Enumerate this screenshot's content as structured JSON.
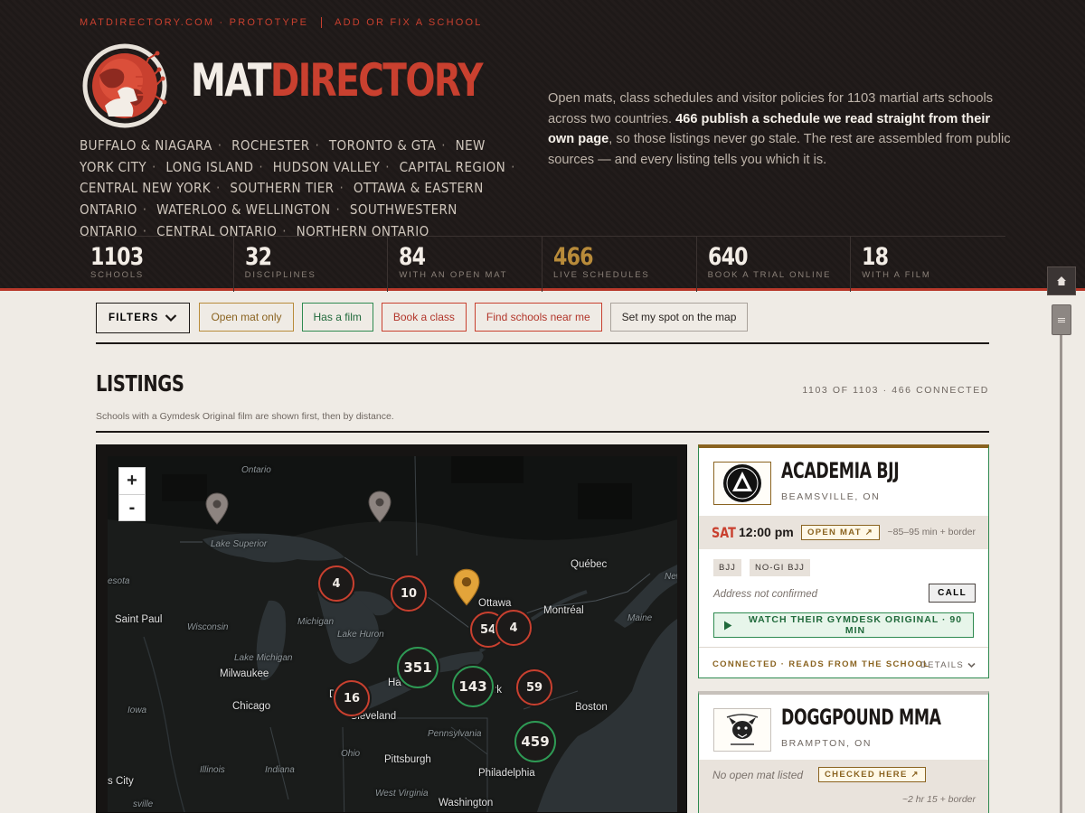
{
  "header": {
    "nav": {
      "site": "MATDIRECTORY.COM · PROTOTYPE",
      "add_fix": "ADD OR FIX A SCHOOL"
    },
    "brand": {
      "part1": "MAT",
      "part2": "DIRECTORY"
    },
    "regions": [
      "BUFFALO & NIAGARA",
      "ROCHESTER",
      "TORONTO & GTA",
      "NEW YORK CITY",
      "LONG ISLAND",
      "HUDSON VALLEY",
      "CAPITAL REGION",
      "CENTRAL NEW YORK",
      "SOUTHERN TIER",
      "OTTAWA & EASTERN ONTARIO",
      "WATERLOO & WELLINGTON",
      "SOUTHWESTERN ONTARIO",
      "CENTRAL ONTARIO",
      "NORTHERN ONTARIO"
    ],
    "intro": {
      "part1": "Open mats, class schedules and visitor policies for 1103 martial arts schools across two countries. ",
      "bold": "466 publish a schedule we read straight from their own page",
      "part2": ", so those listings never go stale. The rest are assembled from public sources — and every listing tells you which it is."
    },
    "stats": [
      {
        "value": "1103",
        "label": "SCHOOLS"
      },
      {
        "value": "32",
        "label": "DISCIPLINES"
      },
      {
        "value": "84",
        "label": "WITH AN OPEN MAT"
      },
      {
        "value": "466",
        "label": "LIVE SCHEDULES"
      },
      {
        "value": "640",
        "label": "BOOK A TRIAL ONLINE"
      },
      {
        "value": "18",
        "label": "WITH A FILM"
      }
    ]
  },
  "filters": {
    "main": "FILTERS",
    "open_mat": "Open mat only",
    "film": "Has a film",
    "book": "Book a class",
    "near": "Find schools near me",
    "spot": "Set my spot on the map"
  },
  "listings": {
    "title": "LISTINGS",
    "count": "1103 OF 1103 · 466 CONNECTED",
    "subtitle": "Schools with a Gymdesk Original film are shown first, then by distance."
  },
  "map": {
    "zoom_in": "+",
    "zoom_out": "-",
    "labels": {
      "ontario": "Ontario",
      "lake_superior": "Lake Superior",
      "esota": "esota",
      "saint_paul": "Saint Paul",
      "wisconsin": "Wisconsin",
      "michigan": "Michigan",
      "lake_huron": "Lake Huron",
      "lake_michigan": "Lake Michigan",
      "milwaukee": "Milwaukee",
      "chicago": "Chicago",
      "iowa": "Iowa",
      "illinois": "Illinois",
      "indiana": "Indiana",
      "ohio": "Ohio",
      "cleveland": "Cleveland",
      "pittsburgh": "Pittsburgh",
      "pennsylvania": "Pennsylvania",
      "philadelphia": "Philadelphia",
      "washington": "Washington",
      "west_virginia": "West Virginia",
      "s_city": "s City",
      "sville": "sville",
      "ottawa": "Ottawa",
      "montreal": "Montréal",
      "quebec": "Québec",
      "maine": "Maine",
      "boston": "Boston",
      "new": "New",
      "ork": "ork",
      "ha": "Ha",
      "d": "D"
    },
    "clusters": {
      "c4a": "4",
      "c10": "10",
      "c54": "54",
      "c4b": "4",
      "c351": "351",
      "c143": "143",
      "c59": "59",
      "c16": "16",
      "c459": "459"
    }
  },
  "cards": [
    {
      "name": "ACADEMIA BJJ",
      "city": "BEAMSVILLE, ON",
      "day": "SAT",
      "time": "12:00 pm",
      "open_mat": "OPEN MAT ↗",
      "distance": "~85–95 min + border",
      "tags": [
        "BJJ",
        "NO-GI BJJ"
      ],
      "address": "Address not confirmed",
      "call": "CALL",
      "watch": "WATCH THEIR GYMDESK ORIGINAL · 90 MIN",
      "connected": "CONNECTED · READS FROM THE SCHOOL",
      "details": "DETAILS"
    },
    {
      "name": "DOGGPOUND MMA",
      "city": "BRAMPTON, ON",
      "no_open_mat": "No open mat listed",
      "checked": "CHECKED HERE ↗",
      "distance": "~2 hr 15 + border"
    }
  ],
  "colors": {
    "accent_red": "#c9402f",
    "gold": "#b88b3a",
    "green": "#2e8a50",
    "dark": "#1e1918"
  }
}
